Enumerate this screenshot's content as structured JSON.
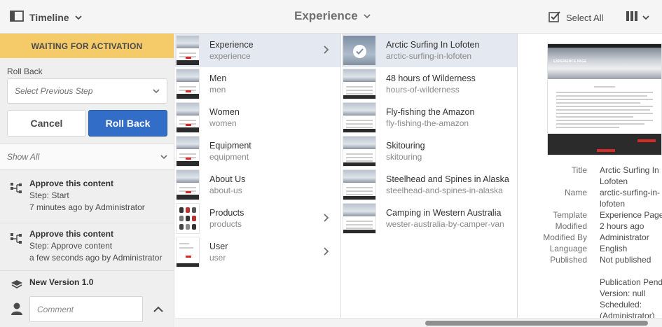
{
  "topbar": {
    "rail_label": "Timeline",
    "breadcrumb": "Experience",
    "select_all": "Select All"
  },
  "rail": {
    "status": "WAITING FOR ACTIVATION",
    "rollback_label": "Roll Back",
    "select_placeholder": "Select Previous Step",
    "cancel": "Cancel",
    "rollback_button": "Roll Back",
    "filter": "Show All",
    "events": [
      {
        "title": "Approve this content",
        "step": "Step: Start",
        "time": "7 minutes ago by Administrator"
      },
      {
        "title": "Approve this content",
        "step": "Step: Approve content",
        "time": "a few seconds ago by Administrator"
      }
    ],
    "version": "New Version 1.0",
    "comment_placeholder": "Comment"
  },
  "column1": [
    {
      "name": "Experience",
      "sub": "experience"
    },
    {
      "name": "Men",
      "sub": "men"
    },
    {
      "name": "Women",
      "sub": "women"
    },
    {
      "name": "Equipment",
      "sub": "equipment"
    },
    {
      "name": "About Us",
      "sub": "about-us"
    },
    {
      "name": "Products",
      "sub": "products"
    },
    {
      "name": "User",
      "sub": "user"
    }
  ],
  "column2": [
    {
      "name": "Arctic Surfing In Lofoten",
      "sub": "arctic-surfing-in-lofoten"
    },
    {
      "name": "48 hours of Wilderness",
      "sub": "hours-of-wilderness"
    },
    {
      "name": "Fly-fishing the Amazon",
      "sub": "fly-fishing-the-amazon"
    },
    {
      "name": "Skitouring",
      "sub": "skitouring"
    },
    {
      "name": "Steelhead and Spines in Alaska",
      "sub": "steelhead-and-spines-in-alaska"
    },
    {
      "name": "Camping in Western Australia",
      "sub": "wester-australia-by-camper-van"
    }
  ],
  "detail": {
    "preview_title": "EXPERIENCE PAGE",
    "rows": [
      {
        "k": "Title",
        "v": [
          "Arctic Surfing In",
          "Lofoten"
        ]
      },
      {
        "k": "Name",
        "v": [
          "arctic-surfing-in-",
          "lofoten"
        ]
      },
      {
        "k": "Template",
        "v": [
          "Experience Page"
        ]
      },
      {
        "k": "Modified",
        "v": [
          "2 hours ago"
        ]
      },
      {
        "k": "Modified By",
        "v": [
          "Administrator"
        ]
      },
      {
        "k": "Language",
        "v": [
          "English"
        ]
      },
      {
        "k": "Published",
        "v": [
          "Not published"
        ]
      },
      {
        "k": "",
        "v": [
          ""
        ]
      },
      {
        "k": "",
        "v": [
          "Publication Pending",
          "Version: null",
          "Scheduled:",
          "(Administrator)"
        ]
      }
    ]
  },
  "colors": {
    "accent": "#326ec8",
    "banner": "#f5cb6a",
    "selected_row": "#e4e9f1"
  }
}
